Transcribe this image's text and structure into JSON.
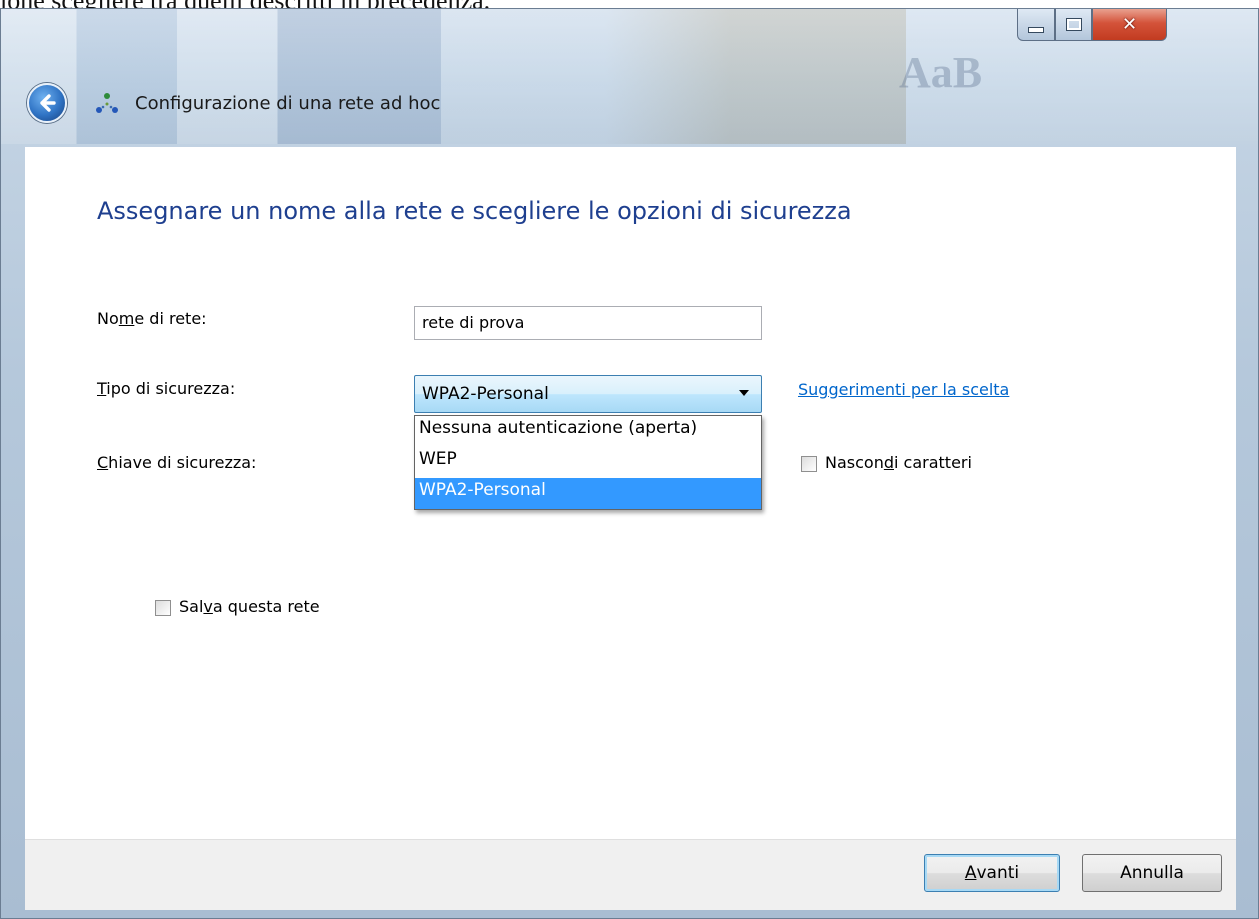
{
  "background_text": "ione scegliere tra quelli descritti in precedenza.",
  "window": {
    "title_buttons": {
      "minimize": "minimize-icon",
      "maximize": "maximize-icon",
      "close": "close-icon"
    },
    "title": "Configurazione di una rete ad hoc"
  },
  "content": {
    "heading": "Assegnare un nome alla rete e scegliere le opzioni di sicurezza",
    "network_name": {
      "label_pre": "No",
      "label_key": "m",
      "label_post": "e di rete:",
      "value": "rete di prova"
    },
    "security_type": {
      "label_key": "T",
      "label_post": "ipo di sicurezza:",
      "selected": "WPA2-Personal",
      "options": [
        "Nessuna autenticazione (aperta)",
        "WEP",
        "WPA2-Personal"
      ],
      "highlighted_index": 2,
      "help_link": "Suggerimenti per la scelta"
    },
    "security_key": {
      "label_key": "C",
      "label_post": "hiave di sicurezza:"
    },
    "hide_chars": {
      "label_pre": "Nascon",
      "label_key": "d",
      "label_post": "i caratteri",
      "checked": false
    },
    "save_network": {
      "label_pre": "Sal",
      "label_key": "v",
      "label_post": "a questa rete",
      "checked": false
    }
  },
  "footer": {
    "next": {
      "key": "A",
      "rest": "vanti"
    },
    "cancel": "Annulla"
  },
  "colors": {
    "heading": "#1e3f8f",
    "link": "#0066cc",
    "selection": "#3399ff"
  }
}
